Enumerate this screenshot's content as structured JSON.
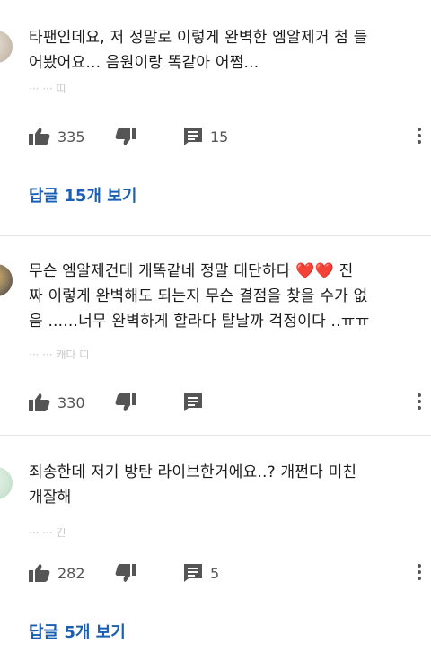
{
  "comments": [
    {
      "text_line1": "타팬인데요, 저 정말로 이렇게 완벽한 엠알제거 첨 들",
      "text_line2": "어봤어요... 음원이랑 똑같아 어쩜...",
      "faded": "··· ··· 띠",
      "likes": "335",
      "replies_count": "15",
      "replies_link": "답글 15개 보기"
    },
    {
      "text_line1": "무슨 엠알제건데 개똑같네 정말 대단하다 ❤️❤️ 진",
      "text_line2": "짜 이렇게 완벽해도 되는지 무슨 결점을 찾을 수가 없",
      "text_line3": "음 ......너무 완벽하게 할라다 탈날까 걱정이다 ..ㅠㅠ",
      "faded": "··· ··· 캐다 띠",
      "likes": "330"
    },
    {
      "text_line1": "죄송한데 저기 방탄 라이브한거에요..? 개쩐다 미친",
      "text_line2": "개잘해",
      "faded": "··· ··· 긴",
      "likes": "282",
      "replies_count": "5",
      "replies_link": "답글 5개 보기"
    }
  ],
  "icons": {
    "like": "thumbs-up-icon",
    "dislike": "thumbs-down-icon",
    "reply": "comment-icon",
    "more": "more-vert-icon"
  },
  "colors": {
    "link": "#1a5fb4",
    "icon": "#555555",
    "text": "#1b1b1b"
  }
}
